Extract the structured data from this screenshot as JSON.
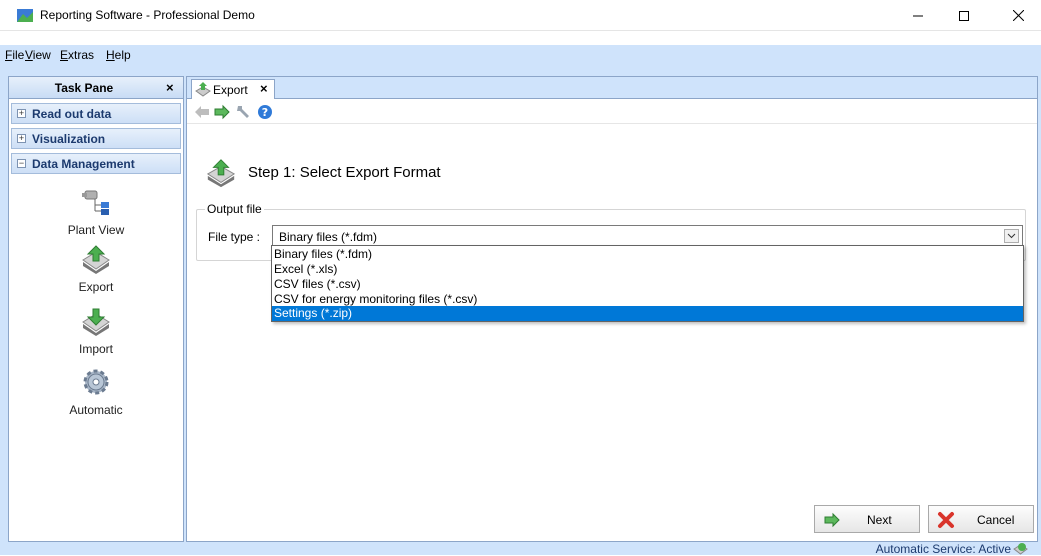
{
  "window": {
    "title": "Reporting Software - Professional Demo",
    "controls": {
      "minimize": "minimize",
      "maximize": "maximize",
      "close": "close"
    }
  },
  "menu": {
    "items": [
      {
        "first": "F",
        "rest": "ile"
      },
      {
        "first": "V",
        "rest": "iew"
      },
      {
        "first": "E",
        "rest": "xtras"
      },
      {
        "first": "H",
        "rest": "elp"
      }
    ]
  },
  "taskpane": {
    "title": "Task Pane",
    "close": "×",
    "sections": [
      {
        "label": "Read out data",
        "expanded": false
      },
      {
        "label": "Visualization",
        "expanded": false
      },
      {
        "label": "Data Management",
        "expanded": true
      }
    ],
    "items": [
      {
        "label": "Plant View",
        "icon": "plant-view-icon"
      },
      {
        "label": "Export",
        "icon": "export-icon"
      },
      {
        "label": "Import",
        "icon": "import-icon"
      },
      {
        "label": "Automatic",
        "icon": "gear-icon"
      }
    ]
  },
  "tab": {
    "label": "Export",
    "close": "×"
  },
  "toolbar": {
    "icons": [
      "back-arrow-icon",
      "forward-arrow-icon",
      "wrench-icon",
      "help-icon"
    ]
  },
  "step": {
    "title": "Step 1: Select Export Format"
  },
  "output": {
    "legend": "Output file",
    "filetype_label": "File type :",
    "filetype_value": "Binary files (*.fdm)",
    "options": [
      "Binary files (*.fdm)",
      "Excel (*.xls)",
      "CSV files (*.csv)",
      "CSV for energy monitoring files (*.csv)",
      "Settings (*.zip)"
    ],
    "highlighted_index": 4
  },
  "buttons": {
    "next": "Next",
    "cancel": "Cancel"
  },
  "status": {
    "text": "Automatic Service: Active"
  },
  "colors": {
    "accent": "#cfe3fb",
    "selection": "#0078d7",
    "section_text": "#1c3a6e"
  }
}
